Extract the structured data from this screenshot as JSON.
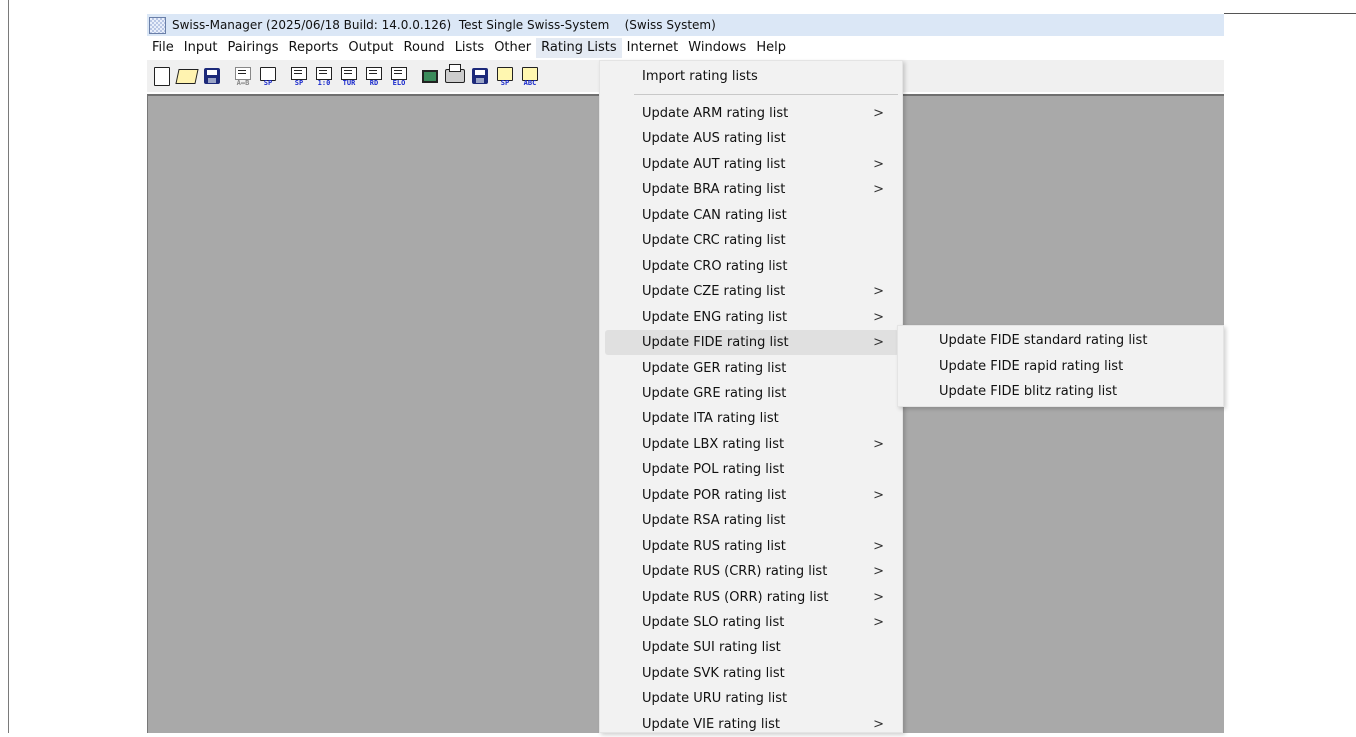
{
  "window": {
    "title": "Swiss-Manager (2025/06/18 Build: 14.0.0.126)  Test Single Swiss-System    (Swiss System)"
  },
  "menubar": {
    "items": [
      {
        "label": "File"
      },
      {
        "label": "Input"
      },
      {
        "label": "Pairings"
      },
      {
        "label": "Reports"
      },
      {
        "label": "Output"
      },
      {
        "label": "Round"
      },
      {
        "label": "Lists"
      },
      {
        "label": "Other"
      },
      {
        "label": "Rating Lists",
        "active": true
      },
      {
        "label": "Internet"
      },
      {
        "label": "Windows"
      },
      {
        "label": "Help"
      }
    ]
  },
  "toolbar": {
    "buttons": [
      {
        "icon": "new-document-icon"
      },
      {
        "icon": "open-folder-icon"
      },
      {
        "icon": "save-icon"
      },
      {
        "icon": "table-a-b-icon",
        "caption": "A↔B"
      },
      {
        "icon": "document-sp-icon",
        "caption": "SP"
      },
      {
        "icon": "table-sp-icon",
        "caption": "SP"
      },
      {
        "icon": "table-1-0-icon",
        "caption": "1:0"
      },
      {
        "icon": "table-tur-icon",
        "caption": "TUR"
      },
      {
        "icon": "table-rd-icon",
        "caption": "RD"
      },
      {
        "icon": "table-elo-icon",
        "caption": "ELO"
      },
      {
        "icon": "monitor-icon"
      },
      {
        "icon": "printer-icon"
      },
      {
        "icon": "save-disk-icon"
      },
      {
        "icon": "document-sp-export-icon",
        "caption": "SP"
      },
      {
        "icon": "document-abc-sort-icon",
        "caption": "ABC"
      }
    ]
  },
  "rating_lists_menu": {
    "header_item": "Import rating lists",
    "items": [
      {
        "label": "Update ARM rating list",
        "submenu": true
      },
      {
        "label": "Update AUS rating list",
        "submenu": false
      },
      {
        "label": "Update AUT rating list",
        "submenu": true
      },
      {
        "label": "Update BRA rating list",
        "submenu": true
      },
      {
        "label": "Update CAN rating list",
        "submenu": false
      },
      {
        "label": "Update CRC rating list",
        "submenu": false
      },
      {
        "label": "Update CRO rating list",
        "submenu": false
      },
      {
        "label": "Update CZE rating list",
        "submenu": true
      },
      {
        "label": "Update ENG rating list",
        "submenu": true
      },
      {
        "label": "Update FIDE rating list",
        "submenu": true,
        "highlighted": true
      },
      {
        "label": "Update GER rating list",
        "submenu": false
      },
      {
        "label": "Update GRE rating list",
        "submenu": false
      },
      {
        "label": "Update ITA rating list",
        "submenu": false
      },
      {
        "label": "Update LBX rating list",
        "submenu": true
      },
      {
        "label": "Update POL rating list",
        "submenu": false
      },
      {
        "label": "Update POR rating list",
        "submenu": true
      },
      {
        "label": "Update RSA rating list",
        "submenu": false
      },
      {
        "label": "Update RUS rating list",
        "submenu": true
      },
      {
        "label": "Update RUS (CRR) rating list",
        "submenu": true
      },
      {
        "label": "Update RUS (ORR) rating list",
        "submenu": true
      },
      {
        "label": "Update SLO rating list",
        "submenu": true
      },
      {
        "label": "Update SUI rating list",
        "submenu": false
      },
      {
        "label": "Update SVK rating list",
        "submenu": false
      },
      {
        "label": "Update URU rating list",
        "submenu": false
      },
      {
        "label": "Update VIE rating list",
        "submenu": true
      }
    ],
    "arrow_glyph": ">"
  },
  "fide_submenu": {
    "items": [
      {
        "label": "Update FIDE standard rating list"
      },
      {
        "label": "Update FIDE rapid rating list"
      },
      {
        "label": "Update FIDE blitz rating list"
      }
    ]
  },
  "colors": {
    "titlebar": "#dbe7f6",
    "workspace": "#a9a9a9",
    "menu_bg": "#f2f2f2",
    "menu_highlight": "#e0e0e0",
    "icon_caption_blue": "#1a2acc"
  }
}
